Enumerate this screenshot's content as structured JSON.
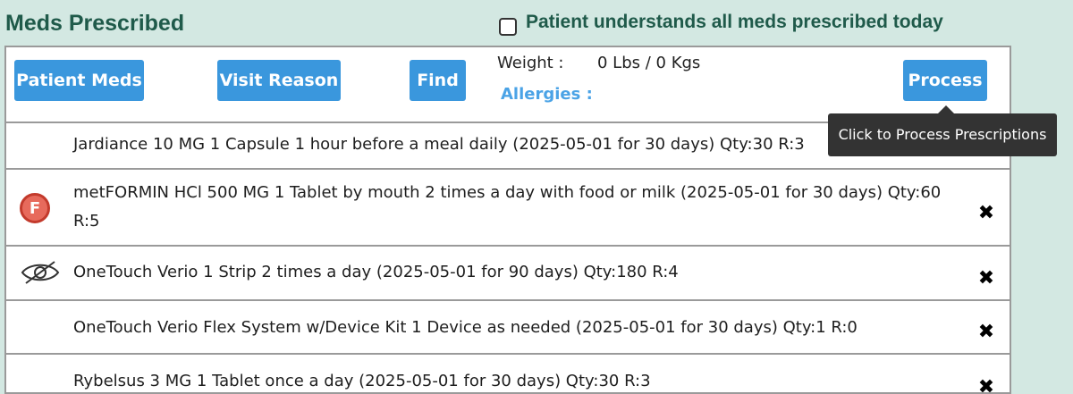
{
  "header": {
    "title": "Meds Prescribed",
    "understand_label": "Patient understands all meds prescribed today",
    "understand_checked": false
  },
  "toolbar": {
    "patient_meds_label": "Patient Meds",
    "visit_reason_label": "Visit Reason",
    "find_label": "Find",
    "process_label": "Process",
    "weight_label": "Weight :",
    "weight_value": "0 Lbs / 0 Kgs",
    "allergies_label": "Allergies :"
  },
  "tooltip": {
    "text": "Click to Process Prescriptions"
  },
  "meds": [
    {
      "text": "Jardiance 10 MG 1 Capsule 1 hour before a meal daily (2025-05-01 for 30 days) Qty:30 R:3",
      "icon": null
    },
    {
      "text": "metFORMIN HCl 500 MG 1 Tablet by mouth 2 times a day with food or milk (2025-05-01 for 30 days) Qty:60 R:5",
      "icon": "formulary-badge-icon",
      "badge": "F"
    },
    {
      "text": "OneTouch Verio 1 Strip 2 times a day (2025-05-01 for 90 days) Qty:180 R:4",
      "icon": "hidden-eye-icon"
    },
    {
      "text": "OneTouch Verio Flex System w/Device Kit 1 Device as needed (2025-05-01 for 30 days) Qty:1 R:0",
      "icon": null
    },
    {
      "text": "Rybelsus 3 MG 1 Tablet once a day (2025-05-01 for 30 days) Qty:30 R:3",
      "icon": null
    }
  ],
  "colors": {
    "background": "#d3e8e2",
    "title": "#1f5a4a",
    "button": "#3a97dd",
    "allergies": "#4ba3e6",
    "badge": "#e76a5c"
  }
}
